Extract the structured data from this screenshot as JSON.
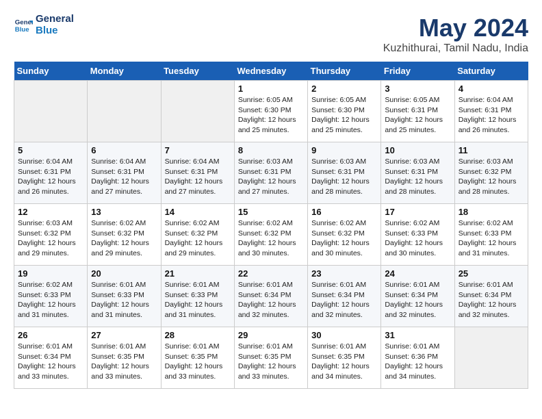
{
  "header": {
    "logo_line1": "General",
    "logo_line2": "Blue",
    "title": "May 2024",
    "location": "Kuzhithurai, Tamil Nadu, India"
  },
  "weekdays": [
    "Sunday",
    "Monday",
    "Tuesday",
    "Wednesday",
    "Thursday",
    "Friday",
    "Saturday"
  ],
  "weeks": [
    [
      {
        "day": "",
        "info": ""
      },
      {
        "day": "",
        "info": ""
      },
      {
        "day": "",
        "info": ""
      },
      {
        "day": "1",
        "info": "Sunrise: 6:05 AM\nSunset: 6:30 PM\nDaylight: 12 hours\nand 25 minutes."
      },
      {
        "day": "2",
        "info": "Sunrise: 6:05 AM\nSunset: 6:30 PM\nDaylight: 12 hours\nand 25 minutes."
      },
      {
        "day": "3",
        "info": "Sunrise: 6:05 AM\nSunset: 6:31 PM\nDaylight: 12 hours\nand 25 minutes."
      },
      {
        "day": "4",
        "info": "Sunrise: 6:04 AM\nSunset: 6:31 PM\nDaylight: 12 hours\nand 26 minutes."
      }
    ],
    [
      {
        "day": "5",
        "info": "Sunrise: 6:04 AM\nSunset: 6:31 PM\nDaylight: 12 hours\nand 26 minutes."
      },
      {
        "day": "6",
        "info": "Sunrise: 6:04 AM\nSunset: 6:31 PM\nDaylight: 12 hours\nand 27 minutes."
      },
      {
        "day": "7",
        "info": "Sunrise: 6:04 AM\nSunset: 6:31 PM\nDaylight: 12 hours\nand 27 minutes."
      },
      {
        "day": "8",
        "info": "Sunrise: 6:03 AM\nSunset: 6:31 PM\nDaylight: 12 hours\nand 27 minutes."
      },
      {
        "day": "9",
        "info": "Sunrise: 6:03 AM\nSunset: 6:31 PM\nDaylight: 12 hours\nand 28 minutes."
      },
      {
        "day": "10",
        "info": "Sunrise: 6:03 AM\nSunset: 6:31 PM\nDaylight: 12 hours\nand 28 minutes."
      },
      {
        "day": "11",
        "info": "Sunrise: 6:03 AM\nSunset: 6:32 PM\nDaylight: 12 hours\nand 28 minutes."
      }
    ],
    [
      {
        "day": "12",
        "info": "Sunrise: 6:03 AM\nSunset: 6:32 PM\nDaylight: 12 hours\nand 29 minutes."
      },
      {
        "day": "13",
        "info": "Sunrise: 6:02 AM\nSunset: 6:32 PM\nDaylight: 12 hours\nand 29 minutes."
      },
      {
        "day": "14",
        "info": "Sunrise: 6:02 AM\nSunset: 6:32 PM\nDaylight: 12 hours\nand 29 minutes."
      },
      {
        "day": "15",
        "info": "Sunrise: 6:02 AM\nSunset: 6:32 PM\nDaylight: 12 hours\nand 30 minutes."
      },
      {
        "day": "16",
        "info": "Sunrise: 6:02 AM\nSunset: 6:32 PM\nDaylight: 12 hours\nand 30 minutes."
      },
      {
        "day": "17",
        "info": "Sunrise: 6:02 AM\nSunset: 6:33 PM\nDaylight: 12 hours\nand 30 minutes."
      },
      {
        "day": "18",
        "info": "Sunrise: 6:02 AM\nSunset: 6:33 PM\nDaylight: 12 hours\nand 31 minutes."
      }
    ],
    [
      {
        "day": "19",
        "info": "Sunrise: 6:02 AM\nSunset: 6:33 PM\nDaylight: 12 hours\nand 31 minutes."
      },
      {
        "day": "20",
        "info": "Sunrise: 6:01 AM\nSunset: 6:33 PM\nDaylight: 12 hours\nand 31 minutes."
      },
      {
        "day": "21",
        "info": "Sunrise: 6:01 AM\nSunset: 6:33 PM\nDaylight: 12 hours\nand 31 minutes."
      },
      {
        "day": "22",
        "info": "Sunrise: 6:01 AM\nSunset: 6:34 PM\nDaylight: 12 hours\nand 32 minutes."
      },
      {
        "day": "23",
        "info": "Sunrise: 6:01 AM\nSunset: 6:34 PM\nDaylight: 12 hours\nand 32 minutes."
      },
      {
        "day": "24",
        "info": "Sunrise: 6:01 AM\nSunset: 6:34 PM\nDaylight: 12 hours\nand 32 minutes."
      },
      {
        "day": "25",
        "info": "Sunrise: 6:01 AM\nSunset: 6:34 PM\nDaylight: 12 hours\nand 32 minutes."
      }
    ],
    [
      {
        "day": "26",
        "info": "Sunrise: 6:01 AM\nSunset: 6:34 PM\nDaylight: 12 hours\nand 33 minutes."
      },
      {
        "day": "27",
        "info": "Sunrise: 6:01 AM\nSunset: 6:35 PM\nDaylight: 12 hours\nand 33 minutes."
      },
      {
        "day": "28",
        "info": "Sunrise: 6:01 AM\nSunset: 6:35 PM\nDaylight: 12 hours\nand 33 minutes."
      },
      {
        "day": "29",
        "info": "Sunrise: 6:01 AM\nSunset: 6:35 PM\nDaylight: 12 hours\nand 33 minutes."
      },
      {
        "day": "30",
        "info": "Sunrise: 6:01 AM\nSunset: 6:35 PM\nDaylight: 12 hours\nand 34 minutes."
      },
      {
        "day": "31",
        "info": "Sunrise: 6:01 AM\nSunset: 6:36 PM\nDaylight: 12 hours\nand 34 minutes."
      },
      {
        "day": "",
        "info": ""
      }
    ]
  ]
}
